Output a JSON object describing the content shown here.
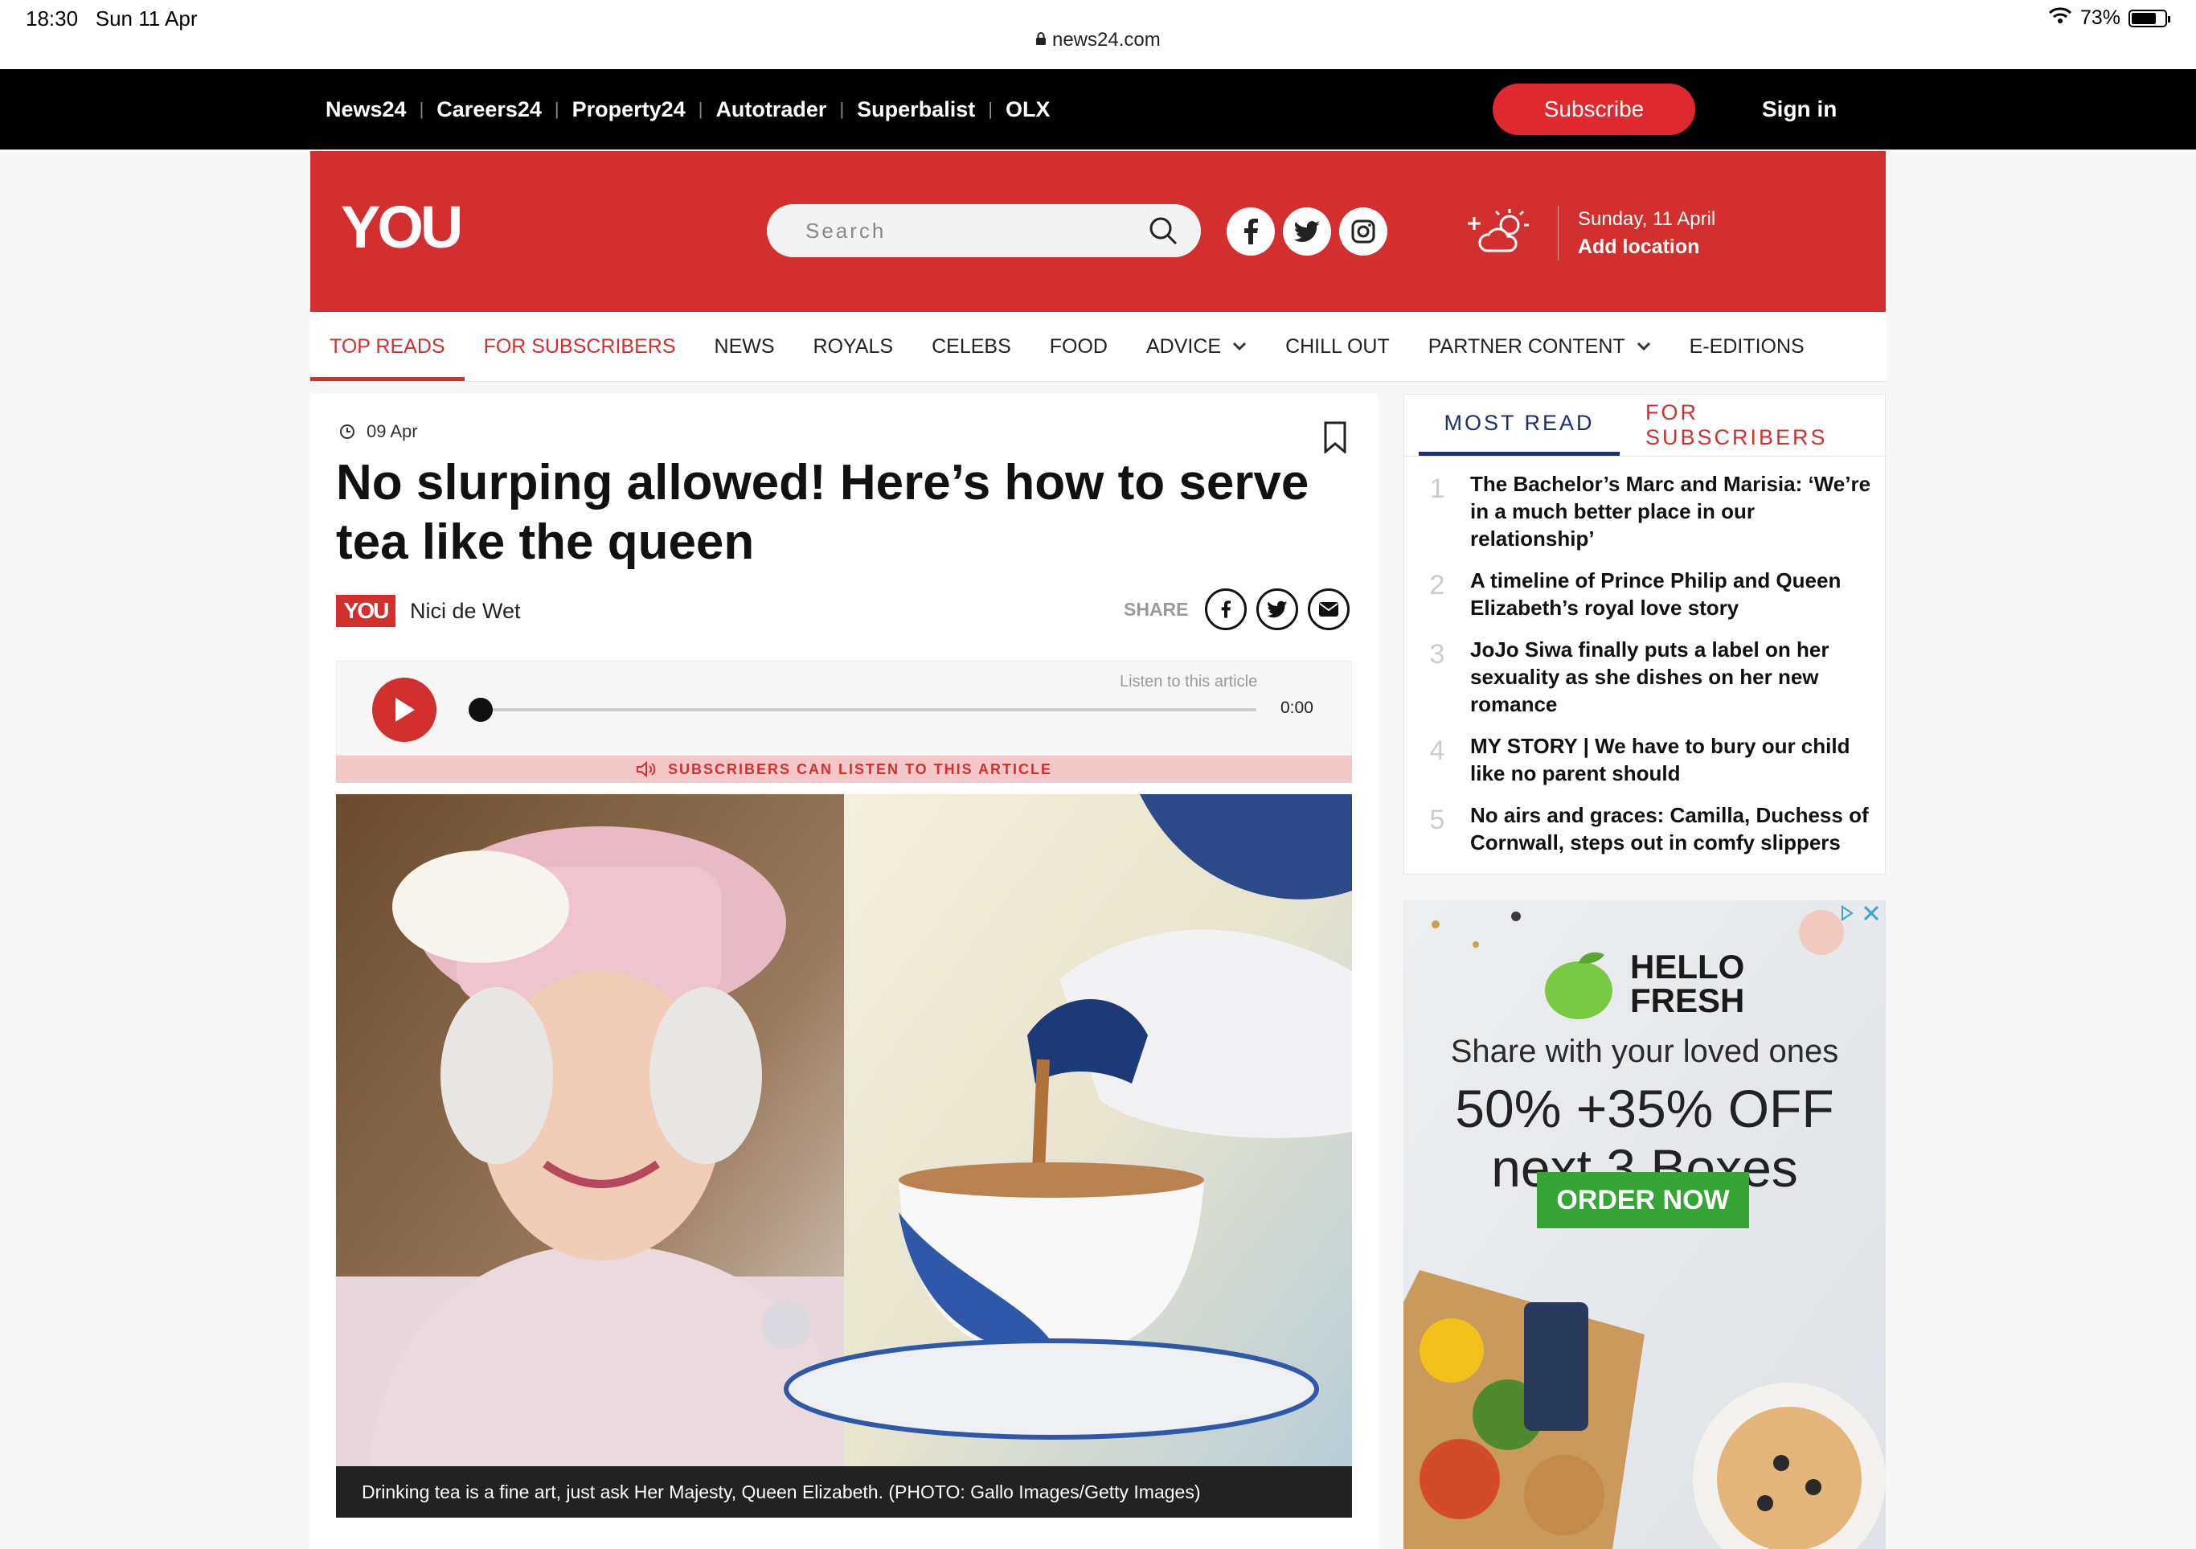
{
  "status": {
    "time": "18:30",
    "date": "Sun 11 Apr",
    "url": "news24.com",
    "battery": "73%"
  },
  "network": {
    "links": [
      "News24",
      "Careers24",
      "Property24",
      "Autotrader",
      "Superbalist",
      "OLX"
    ],
    "subscribe_label": "Subscribe",
    "signin_label": "Sign in"
  },
  "header": {
    "logo": "YOU",
    "search_placeholder": "Search",
    "date": "Sunday, 11 April",
    "location_label": "Add location"
  },
  "nav": {
    "items": [
      "TOP READS",
      "FOR SUBSCRIBERS",
      "NEWS",
      "ROYALS",
      "CELEBS",
      "FOOD",
      "ADVICE",
      "CHILL OUT",
      "PARTNER CONTENT",
      "E-EDITIONS"
    ]
  },
  "article": {
    "date": "09 Apr",
    "headline": "No slurping allowed! Here’s how to serve tea like the queen",
    "badge": "YOU",
    "author": "Nici de Wet",
    "share_label": "SHARE",
    "listen_label": "Listen to this article",
    "time": "0:00",
    "subscribers_notice": "SUBSCRIBERS CAN LISTEN TO THIS ARTICLE",
    "caption": "Drinking tea is a fine art, just ask Her Majesty, Queen Elizabeth. (PHOTO: Gallo Images/Getty Images)"
  },
  "sidebar": {
    "tabs": [
      "MOST READ",
      "FOR SUBSCRIBERS"
    ],
    "items": [
      {
        "num": "1",
        "title": "The Bachelor’s Marc and Marisia: ‘We’re in a much better place in our relationship’"
      },
      {
        "num": "2",
        "title": "A timeline of Prince Philip and Queen Elizabeth’s royal love story"
      },
      {
        "num": "3",
        "title": "JoJo Siwa finally puts a label on her sexuality as she dishes on her new romance"
      },
      {
        "num": "4",
        "title": "MY STORY | We have to bury our child like no parent should"
      },
      {
        "num": "5",
        "title": "No airs and graces: Camilla, Duchess of Cornwall, steps out in comfy slippers"
      }
    ]
  },
  "ad": {
    "brand_line1": "HELLO",
    "brand_line2": "FRESH",
    "tagline": "Share with your loved ones",
    "offer_line1": "50% +35% OFF",
    "offer_line2": "next 3 Boxes",
    "cta": "ORDER NOW"
  },
  "colors": {
    "brand_red": "#d32f2f",
    "navy": "#1f2f6b",
    "ad_green": "#36a437"
  }
}
